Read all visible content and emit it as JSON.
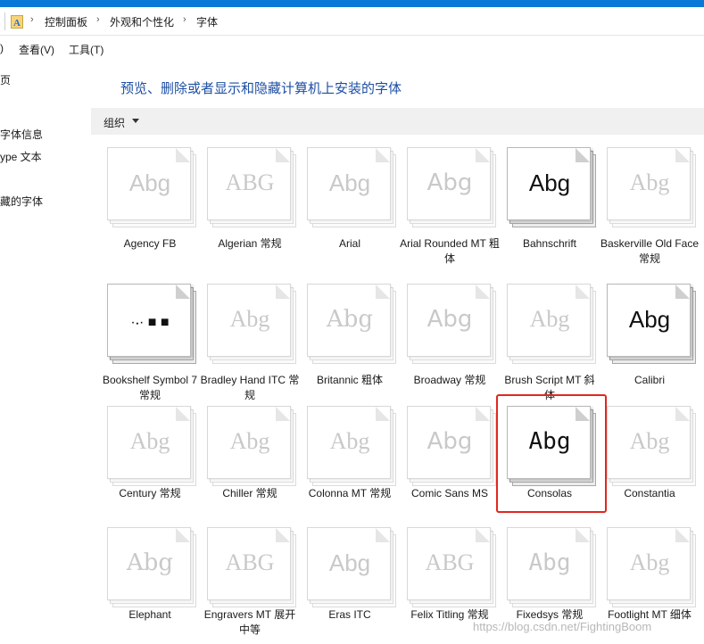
{
  "window": {
    "breadcrumbs": [
      "控制面板",
      "外观和个性化",
      "字体"
    ]
  },
  "menubar": {
    "partial_left": ")",
    "view": "查看(V)",
    "tools": "工具(T)"
  },
  "left_pane": {
    "links": [
      "页",
      "字体信息",
      "ype 文本",
      "藏的字体"
    ]
  },
  "main": {
    "heading": "预览、删除或者显示和隐藏计算机上安装的字体",
    "toolbar": {
      "organize": "组织"
    }
  },
  "fonts": [
    {
      "name": "Agency FB",
      "sample": "Abg",
      "installed": false
    },
    {
      "name": "Algerian 常规",
      "sample": "ABG",
      "installed": false
    },
    {
      "name": "Arial",
      "sample": "Abg",
      "installed": false
    },
    {
      "name": "Arial Rounded MT 粗体",
      "sample": "Abg",
      "installed": false
    },
    {
      "name": "Bahnschrift",
      "sample": "Abg",
      "installed": true
    },
    {
      "name": "Baskerville Old Face 常规",
      "sample": "Abg",
      "installed": false
    },
    {
      "name": "Bookshelf Symbol 7 常规",
      "sample": "·⸳·  ■  ■",
      "installed": true
    },
    {
      "name": "Bradley Hand ITC 常规",
      "sample": "Abg",
      "installed": false
    },
    {
      "name": "Britannic 粗体",
      "sample": "Abg",
      "installed": false
    },
    {
      "name": "Broadway 常规",
      "sample": "Abg",
      "installed": false
    },
    {
      "name": "Brush Script MT 斜体",
      "sample": "Abg",
      "installed": false
    },
    {
      "name": "Calibri",
      "sample": "Abg",
      "installed": true
    },
    {
      "name": "Century 常规",
      "sample": "Abg",
      "installed": false
    },
    {
      "name": "Chiller 常规",
      "sample": "Abg",
      "installed": false
    },
    {
      "name": "Colonna MT 常规",
      "sample": "Abg",
      "installed": false
    },
    {
      "name": "Comic Sans MS",
      "sample": "Abg",
      "installed": false
    },
    {
      "name": "Consolas",
      "sample": "Abg",
      "installed": true
    },
    {
      "name": "Constantia",
      "sample": "Abg",
      "installed": false
    },
    {
      "name": "Elephant",
      "sample": "Abg",
      "installed": false
    },
    {
      "name": "Engravers MT 展开 中等",
      "sample": "ABG",
      "installed": false
    },
    {
      "name": "Eras ITC",
      "sample": "Abg",
      "installed": false
    },
    {
      "name": "Felix Titling 常规",
      "sample": "ABG",
      "installed": false
    },
    {
      "name": "Fixedsys 常规",
      "sample": "Abg",
      "installed": false
    },
    {
      "name": "Footlight MT 细体",
      "sample": "Abg",
      "installed": false
    }
  ],
  "watermark": "https://blog.csdn.net/FightingBoom",
  "colors": {
    "accent_bar": "#0a78d7",
    "heading": "#1e4fa3",
    "highlight_border": "#e0281f",
    "toolbar_bg": "#f0f0f0"
  }
}
